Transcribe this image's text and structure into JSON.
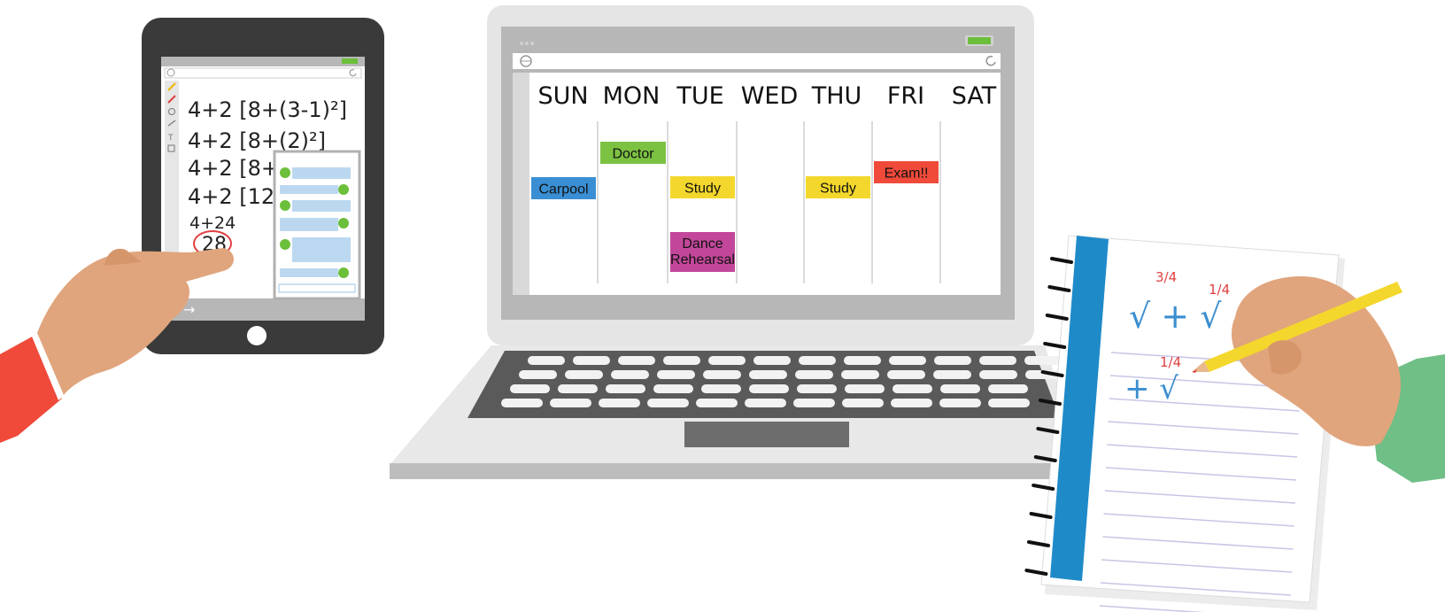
{
  "calendar": {
    "days": [
      "SUN",
      "MON",
      "TUE",
      "WED",
      "THU",
      "FRI",
      "SAT"
    ],
    "events": [
      {
        "label": "Carpool",
        "color": "#3a8fd4"
      },
      {
        "label": "Doctor",
        "color": "#7cc242"
      },
      {
        "label": "Study",
        "color": "#f4d72c"
      },
      {
        "label": "Dance",
        "label2": "Rehearsal",
        "color": "#c2479a"
      },
      {
        "label": "Study",
        "color": "#f4d72c"
      },
      {
        "label": "Exam!!",
        "color": "#ef4a3a"
      }
    ]
  },
  "tablet": {
    "lines": [
      "4+2 [8+(3-1)²]",
      "4+2 [8+(2)²]",
      "4+2 [8+4",
      "4+2 [12]",
      "4+24",
      "28"
    ],
    "arrow_glyph": "→"
  },
  "notebook": {
    "fractions": [
      "3/4",
      "1/4",
      "1/4"
    ],
    "math": [
      "√ + √",
      "+ √"
    ]
  },
  "colors": {
    "laptop_body": "#e3e4e3",
    "laptop_frame": "#b5b5b5",
    "keyboard": "#565656",
    "tablet_body": "#3a3a3a",
    "skin": "#e0a57d",
    "sleeve_left": "#ef4a3a",
    "sleeve_right": "#6fbf86",
    "notebook_spine": "#1f8ac8",
    "pencil": "#f4d72c"
  }
}
